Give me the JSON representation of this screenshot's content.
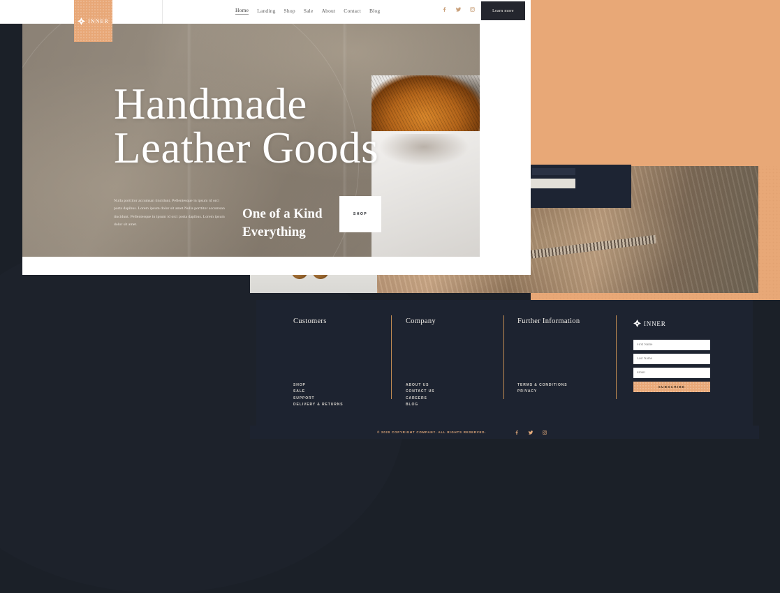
{
  "brand": {
    "name": "INNER",
    "logo_icon": "diamond-logo-icon",
    "accent_color": "#e8a878",
    "dark_color": "#1d2330"
  },
  "header": {
    "nav_items": [
      {
        "label": "Home",
        "active": true
      },
      {
        "label": "Landing",
        "active": false
      },
      {
        "label": "Shop",
        "active": false
      },
      {
        "label": "Sale",
        "active": false
      },
      {
        "label": "About",
        "active": false
      },
      {
        "label": "Contact",
        "active": false
      },
      {
        "label": "Blog",
        "active": false
      }
    ],
    "social": [
      {
        "name": "facebook-icon"
      },
      {
        "name": "twitter-icon"
      },
      {
        "name": "instagram-icon"
      }
    ],
    "cta_label": "Learn more"
  },
  "hero": {
    "title": "Handmade\nLeather Goods",
    "paragraph": "Nulla porttitor accumsan tincidunt. Pellentesque in ipsum id orci porta dapibus. Lorem ipsum dolor sit amet.Nulla porttitor accumsan tincidunt. Pellentesque in ipsum id orci porta dapibus. Lorem ipsum dolor sit amet.",
    "subtitle": "One of a Kind\nEverything",
    "shop_label": "SHOP"
  },
  "footer": {
    "columns": [
      {
        "heading": "Customers",
        "links": [
          "SHOP",
          "SALE",
          "SUPPORT",
          "DELIVERY & RETURNS"
        ]
      },
      {
        "heading": "Company",
        "links": [
          "ABOUT US",
          "CONTACT US",
          "CAREERS",
          "BLOG"
        ]
      },
      {
        "heading": "Further Information",
        "links": [
          "TERMS & CONDITIONS",
          "PRIVACY"
        ]
      }
    ],
    "subscribe": {
      "brand": "INNER",
      "first_name_placeholder": "First Name",
      "last_name_placeholder": "Last Name",
      "email_placeholder": "Email",
      "button_label": "SUBSCRIBE"
    },
    "copyright": "© 2020 COPYRIGHT COMPANY. ALL RIGHTS RESERVED.",
    "social": [
      {
        "name": "facebook-icon"
      },
      {
        "name": "twitter-icon"
      },
      {
        "name": "instagram-icon"
      }
    ]
  }
}
